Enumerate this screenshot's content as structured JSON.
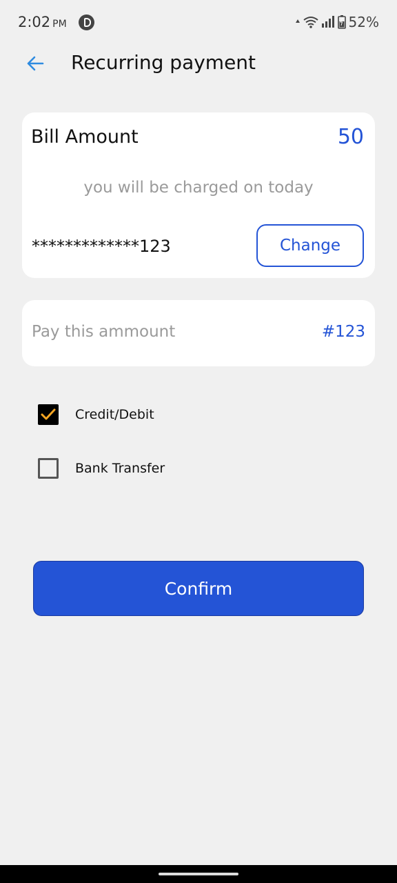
{
  "status_bar": {
    "time": "2:02",
    "ampm": "PM",
    "battery": "52%",
    "icons": [
      "app-notification-icon",
      "wifi-icon",
      "signal-icon",
      "battery-icon"
    ]
  },
  "header": {
    "title": "Recurring payment",
    "back_icon": "arrow-left-icon"
  },
  "bill_card": {
    "label": "Bill Amount",
    "amount": "50",
    "charge_note": "you will be charged on today",
    "card_number": "*************123",
    "change_label": "Change"
  },
  "pay_card": {
    "label": "Pay this ammount",
    "value": "#123"
  },
  "payment_options": [
    {
      "label": "Credit/Debit",
      "checked": true
    },
    {
      "label": "Bank Transfer",
      "checked": false
    }
  ],
  "confirm_label": "Confirm",
  "colors": {
    "accent": "#2454d6",
    "back_arrow": "#2f8be0",
    "check_mark": "#f5a623",
    "background": "#f0f0f0"
  }
}
